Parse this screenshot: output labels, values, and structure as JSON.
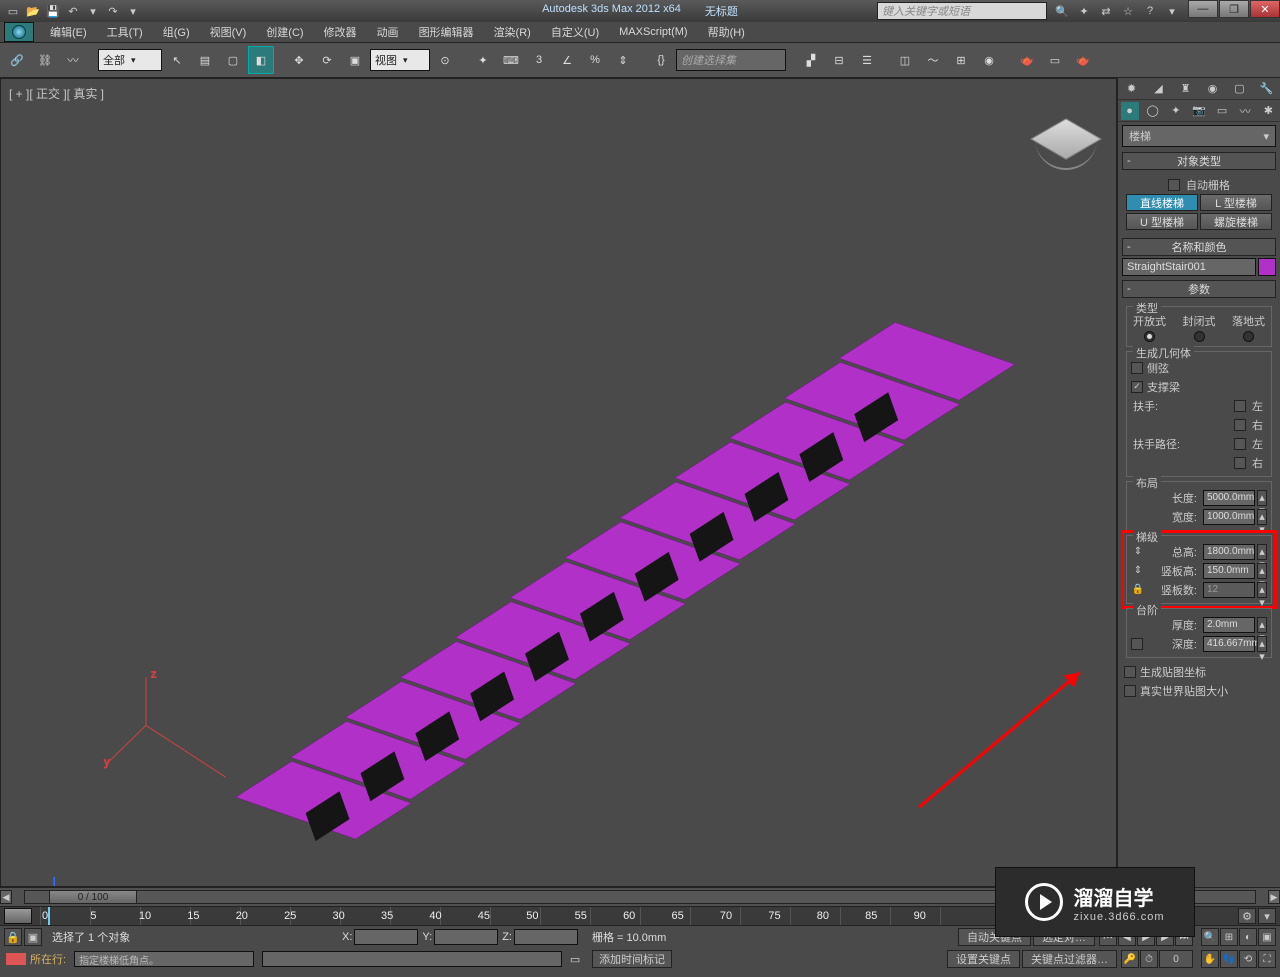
{
  "title": {
    "app": "Autodesk 3ds Max 2012 x64",
    "doc": "无标题"
  },
  "search_placeholder": "键入关键字或短语",
  "win_btns": {
    "min": "—",
    "max": "❐",
    "close": "✕"
  },
  "menu": [
    "编辑(E)",
    "工具(T)",
    "组(G)",
    "视图(V)",
    "创建(C)",
    "修改器",
    "动画",
    "图形编辑器",
    "渲染(R)",
    "自定义(U)",
    "MAXScript(M)",
    "帮助(H)"
  ],
  "toolbar": {
    "filter_all": "全部",
    "view_sel": "视图",
    "named_sel": "创建选择集"
  },
  "viewport_label": "[ + ][ 正交 ][ 真实 ]",
  "command_panel": {
    "dropdown": "楼梯",
    "rollout_type": "对象类型",
    "autogrid": "自动栅格",
    "stair_btns": [
      "直线楼梯",
      "L 型楼梯",
      "U 型楼梯",
      "螺旋楼梯"
    ],
    "rollout_name": "名称和颜色",
    "name_value": "StraightStair001",
    "rollout_params": "参数",
    "group_type": "类型",
    "type_opts": [
      "开放式",
      "封闭式",
      "落地式"
    ],
    "group_gen": "生成几何体",
    "gen_chks": {
      "stringers": "侧弦",
      "carriage": "支撑梁",
      "handrail": "扶手:",
      "handrail_l": "左",
      "handrail_r": "右",
      "railpath": "扶手路径:",
      "railpath_l": "左",
      "railpath_r": "右"
    },
    "group_layout": "布局",
    "layout_len": "长度:",
    "layout_len_v": "5000.0mm",
    "layout_wid": "宽度:",
    "layout_wid_v": "1000.0mm",
    "group_rise": "梯级",
    "rise_total": "总高:",
    "rise_total_v": "1800.0mm",
    "riser_h": "竖板高:",
    "riser_h_v": "150.0mm",
    "riser_ct": "竖板数:",
    "riser_ct_v": "12",
    "group_steps": "台阶",
    "step_thk": "厚度:",
    "step_thk_v": "2.0mm",
    "step_dep": "深度:",
    "step_dep_v": "416.667mm",
    "gen_uv": "生成贴图坐标",
    "real_world": "真实世界贴图大小"
  },
  "timeslider": "0 / 100",
  "timeline_ticks": [
    "0",
    "5",
    "10",
    "15",
    "20",
    "25",
    "30",
    "35",
    "40",
    "45",
    "50",
    "55",
    "60",
    "65",
    "70",
    "75",
    "80",
    "85",
    "90"
  ],
  "status": {
    "sel_msg": "选择了 1 个对象",
    "x": "X:",
    "y": "Y:",
    "z": "Z:",
    "grid": "栅格 = 10.0mm",
    "auto_key": "自动关键点",
    "sel_lock": "选定对…",
    "set_key": "设置关键点",
    "key_filters": "关键点过滤器…",
    "current_line": "所在行:",
    "prompt": "指定楼梯低角点。",
    "add_tag": "添加时间标记"
  },
  "watermark": {
    "big": "溜溜自学",
    "small": "zixue.3d66.com"
  }
}
